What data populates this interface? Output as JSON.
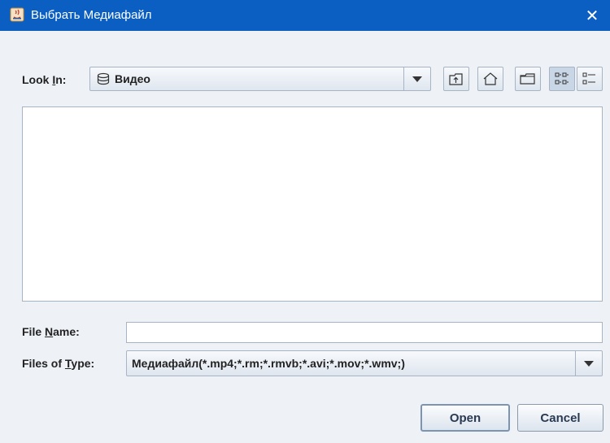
{
  "window": {
    "title": "Выбрать Медиафайл",
    "close_glyph": "✕"
  },
  "lookin": {
    "label_pre": "Look ",
    "label_mnemonic": "I",
    "label_post": "n:",
    "value": "Видео"
  },
  "toolbar": {
    "icons": [
      "up-folder-icon",
      "home-icon",
      "new-folder-icon",
      "list-view-icon",
      "details-view-icon"
    ]
  },
  "filename": {
    "label_pre": "File ",
    "label_mnemonic": "N",
    "label_post": "ame:",
    "value": ""
  },
  "filetype": {
    "label_pre": "Files of ",
    "label_mnemonic": "T",
    "label_post": "ype:",
    "value": "Медиафайл(*.mp4;*.rm;*.rmvb;*.avi;*.mov;*.wmv;)"
  },
  "buttons": {
    "open": "Open",
    "cancel": "Cancel"
  },
  "colors": {
    "titlebar": "#0b5ec2",
    "background": "#eef2f7"
  }
}
